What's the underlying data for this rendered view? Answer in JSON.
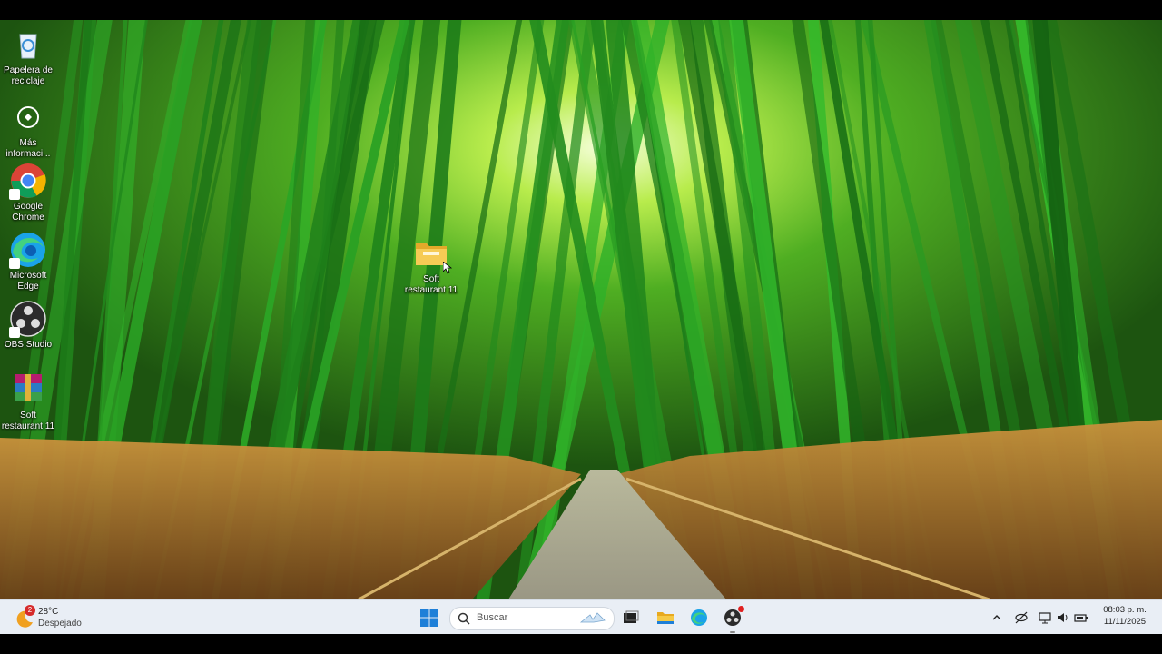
{
  "desktop": {
    "icons": [
      {
        "name": "recycle-bin-icon",
        "label": "Papelera de\nreciclaje"
      },
      {
        "name": "more-info-icon",
        "label": "Más\ninformaci..."
      },
      {
        "name": "google-chrome-icon",
        "label": "Google\nChrome"
      },
      {
        "name": "microsoft-edge-icon",
        "label": "Microsoft\nEdge"
      },
      {
        "name": "obs-studio-icon",
        "label": "OBS Studio"
      },
      {
        "name": "winrar-archive-icon",
        "label": "Soft\nrestaurant 11"
      }
    ],
    "folder": {
      "name": "folder-icon",
      "label": "Soft\nrestaurant 11"
    }
  },
  "taskbar": {
    "weather": {
      "temp": "28°C",
      "condition": "Despejado",
      "badge": "2"
    },
    "search": {
      "placeholder": "Buscar"
    },
    "clock": {
      "time": "08:03 p. m.",
      "date": "11/11/2025"
    }
  }
}
